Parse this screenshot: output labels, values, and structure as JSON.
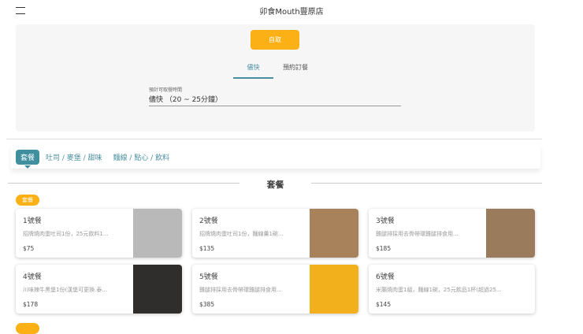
{
  "header": {
    "title": "卯食Mouth豐原店",
    "menu_icon": "hamburger-icon"
  },
  "order": {
    "pickup_label": "自取",
    "tabs": [
      "儘快",
      "預約訂餐"
    ],
    "field_label": "預計可取餐時間",
    "field_value": "儘快 （20 ~ 25分鐘）"
  },
  "categories": [
    "套餐",
    "吐司 / 麥堡 / 甜味",
    "麵線 / 點心 / 飲料"
  ],
  "section": {
    "title": "套餐",
    "badge": "套餐"
  },
  "items": [
    {
      "name": "1號餐",
      "desc": "招牌燒肉蛋吐司1份，25元飲料1...",
      "price": "$75",
      "img_color": "#b9b9b9"
    },
    {
      "name": "2號餐",
      "desc": "招牌燒肉蛋吐司1份，麵線羹1碗...",
      "price": "$135",
      "img_color": "#a7825a"
    },
    {
      "name": "3號餐",
      "desc": "雞腿排採用去骨帶環雞腿排食用...",
      "price": "$185",
      "img_color": "#9a7b5c"
    },
    {
      "name": "4號餐",
      "desc": "川味辣牛黑堡1份(漢堡可更換.泰...",
      "price": "$178",
      "img_color": "#2f2e2c"
    },
    {
      "name": "5號餐",
      "desc": "雞腿排採用去骨帶環雞腿排食用...",
      "price": "$385",
      "img_color": "#f2b11c"
    },
    {
      "name": "6號餐",
      "desc": "米腸燒肉蛋1組，麵線1碗，25元飲品1杯(超過25...",
      "price": "$145",
      "img_color": ""
    }
  ]
}
